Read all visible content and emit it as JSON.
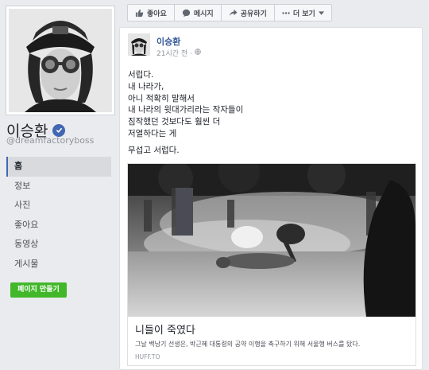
{
  "page": {
    "name": "이승환",
    "username": "@dreamfactoryboss",
    "verified": true
  },
  "nav": {
    "items": [
      {
        "label": "홈",
        "active": true
      },
      {
        "label": "정보",
        "active": false
      },
      {
        "label": "사진",
        "active": false
      },
      {
        "label": "좋아요",
        "active": false
      },
      {
        "label": "동영상",
        "active": false
      },
      {
        "label": "게시물",
        "active": false
      }
    ],
    "create_page_label": "페이지 만들기"
  },
  "actions": {
    "like": "좋아요",
    "message": "메시지",
    "share": "공유하기",
    "more": "더 보기"
  },
  "post": {
    "author": "이승환",
    "time": "21시간 전 ·",
    "lines": [
      "서럽다.",
      "내 나라가,",
      "아니 적확히 말해서",
      "내 나라의 윗대가리라는 작자들이",
      "짐작했던 것보다도 훨씬 더",
      "저열하다는 게"
    ],
    "closing_line": "무섭고 서럽다.",
    "link": {
      "title": "니들이 죽였다",
      "description": "그날 백남기 선생은, 박근혜 대통령의 공약 이행을 촉구하기 위해 서울행 버스를 탔다.",
      "domain": "HUFF.TO"
    }
  },
  "colors": {
    "background": "#e9ebee",
    "link_blue": "#365899",
    "verified_blue": "#4267b2",
    "create_green": "#42b72a"
  },
  "icons": {
    "like": "thumbs-up-icon",
    "message": "message-bubble-icon",
    "share": "share-arrow-icon",
    "more": "chevron-down-icon",
    "audience": "globe-icon"
  }
}
